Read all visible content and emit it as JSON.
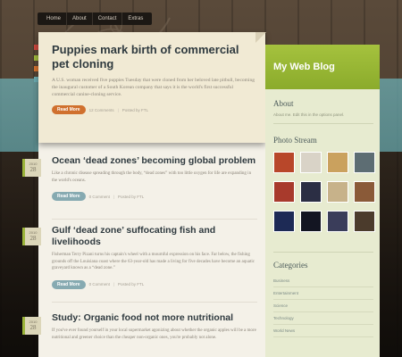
{
  "nav": {
    "items": [
      "Home",
      "About",
      "Contact",
      "Extras"
    ]
  },
  "colors": {
    "accent_green": "#9cb53b",
    "accent_orange": "#d0702e",
    "accent_teal": "#86aab1",
    "tabs": [
      "#c8463c",
      "#9cb53b",
      "#d0702e",
      "#6aa8ad"
    ]
  },
  "featured": {
    "title": "Puppies mark birth of commercial pet cloning",
    "excerpt": "A U.S. woman received five puppies Tuesday that were cloned from her beloved late pitbull, becoming the inaugural customer of a South Korean company that says it is the world's first successful commercial canine-cloning service.",
    "read_more": "Read More",
    "comments": "12 Comments",
    "author": "Posted by FTL"
  },
  "posts": [
    {
      "date_month": "2010",
      "date_day": "28",
      "title": "Ocean ‘dead zones’ becoming global problem",
      "excerpt": "Like a chronic disease spreading through the body, “dead zones” with too little oxygen for life are expanding in the world's oceans.",
      "read_more": "Read More",
      "comments": "0 Comment",
      "author": "Posted by FTL"
    },
    {
      "date_month": "2010",
      "date_day": "28",
      "title": "Gulf ‘dead zone’ suffocating fish and livelihoods",
      "excerpt": "Fisherman Terry Pizani turns his captain's wheel with a mournful expression on his face. Far below, the fishing grounds off the Louisiana coast where the 63-year-old has made a living for five decades have become an aquatic graveyard known as a “dead zone.”",
      "read_more": "Read More",
      "comments": "0 Comment",
      "author": "Posted by FTL"
    },
    {
      "date_month": "2010",
      "date_day": "28",
      "title": "Study: Organic food not more nutritional",
      "excerpt": "If you've ever found yourself in your local supermarket agonizing about whether the organic apples will be a more nutritional and greener choice than the cheaper non-organic ones, you're probably not alone."
    }
  ],
  "sidebar": {
    "title": "My Web Blog",
    "about_heading": "About",
    "about_text": "About me. Edit this in the options panel.",
    "photo_heading": "Photo Stream",
    "photos": [
      {
        "color": "#b8472a"
      },
      {
        "color": "#d9d3c7"
      },
      {
        "color": "#caa15e"
      },
      {
        "color": "#5d6d73"
      },
      {
        "color": "#a83a2c"
      },
      {
        "color": "#2b2e44"
      },
      {
        "color": "#c7b28a"
      },
      {
        "color": "#8a5a38"
      },
      {
        "color": "#1d2a55"
      },
      {
        "color": "#131522"
      },
      {
        "color": "#3a3d5a"
      },
      {
        "color": "#4b3b2c"
      }
    ],
    "categories_heading": "Categories",
    "categories": [
      "Business",
      "Entertainment",
      "Science",
      "Technology",
      "World News"
    ]
  }
}
